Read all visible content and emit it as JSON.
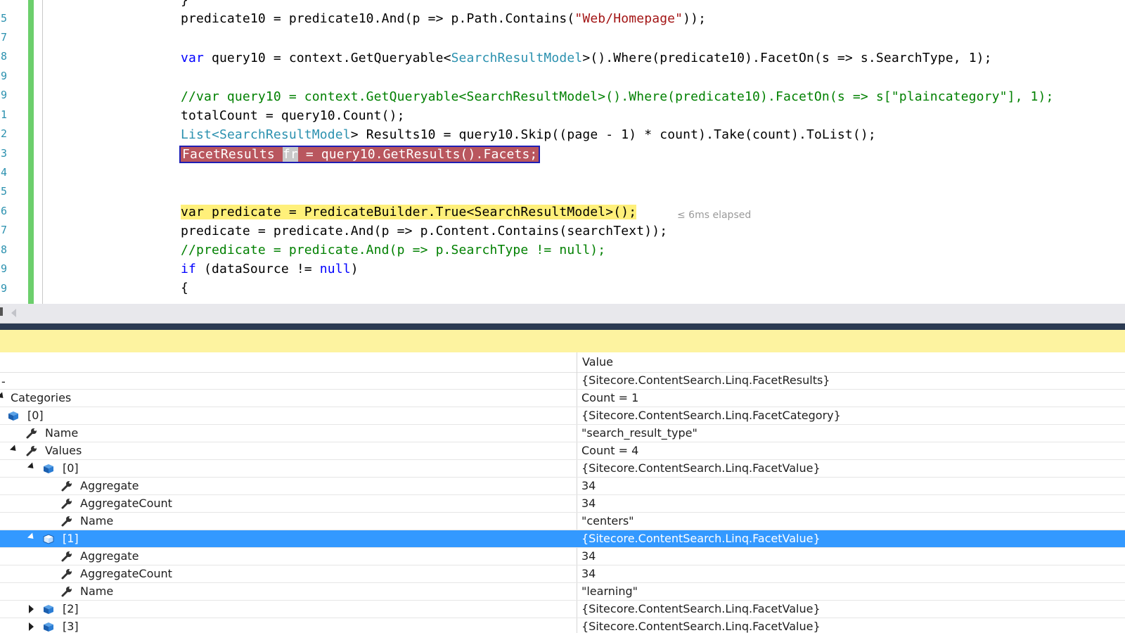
{
  "line_numbers": [
    "5",
    "7",
    "8",
    "9",
    "9",
    "1",
    "2",
    "3",
    "4",
    "5",
    "6",
    "7",
    "8",
    "9",
    "9"
  ],
  "code": {
    "l0": "}",
    "l1_a": "predicate10 = predicate10.And(p => p.Path.Contains(",
    "l1_str": "\"Web/Homepage\"",
    "l1_b": "));",
    "l2_kw": "var",
    "l2_a": " query10 = context.GetQueryable<",
    "l2_type": "SearchResultModel",
    "l2_b": ">().Where(predicate10).FacetOn(s => s.SearchType, 1);",
    "l3_comment": "//var query10 = context.GetQueryable<SearchResultModel>().Where(predicate10).FacetOn(s => s[\"plaincategory\"], 1);",
    "l4": "totalCount = query10.Count();",
    "l5_type1": "List",
    "l5_lt": "<",
    "l5_type2": "SearchResultModel",
    "l5_b": "> Results10 = query10.Skip((page - 1) * count).Take(count).ToList();",
    "l6_a": "FacetResults ",
    "l6_var": "fr",
    "l6_b": " = query10.GetResults().Facets;",
    "l7": "var predicate = PredicateBuilder.True<SearchResultModel>();",
    "l7_elapsed": "≤ 6ms elapsed",
    "l8": "predicate = predicate.And(p => p.Content.Contains(searchText));",
    "l9_comment": "//predicate = predicate.And(p => p.SearchType != null);",
    "l10_kw": "if",
    "l10_a": " (dataSource != ",
    "l10_null": "null",
    "l10_b": ")",
    "l11": "{"
  },
  "watch": {
    "value_header": "Value",
    "rows": [
      {
        "name": "",
        "value": "{Sitecore.ContentSearch.Linq.FacetResults}"
      },
      {
        "name": "Categories",
        "value": "Count = 1"
      },
      {
        "name": "[0]",
        "value": "{Sitecore.ContentSearch.Linq.FacetCategory}"
      },
      {
        "name": "Name",
        "value": "\"search_result_type\""
      },
      {
        "name": "Values",
        "value": "Count = 4"
      },
      {
        "name": "[0]",
        "value": "{Sitecore.ContentSearch.Linq.FacetValue}"
      },
      {
        "name": "Aggregate",
        "value": "34"
      },
      {
        "name": "AggregateCount",
        "value": "34"
      },
      {
        "name": "Name",
        "value": "\"centers\""
      },
      {
        "name": "[1]",
        "value": "{Sitecore.ContentSearch.Linq.FacetValue}"
      },
      {
        "name": "Aggregate",
        "value": "34"
      },
      {
        "name": "AggregateCount",
        "value": "34"
      },
      {
        "name": "Name",
        "value": "\"learning\""
      },
      {
        "name": "[2]",
        "value": "{Sitecore.ContentSearch.Linq.FacetValue}"
      },
      {
        "name": "[3]",
        "value": "{Sitecore.ContentSearch.Linq.FacetValue}"
      }
    ]
  },
  "colors": {
    "keyword": "#0000ff",
    "type": "#2b91af",
    "string": "#a31515",
    "comment": "#008000",
    "active_statement": "#b9565e",
    "current_statement": "#fff07a",
    "selection": "#3399ff",
    "change_bar": "#6ccf6c"
  },
  "icons": {
    "object": "object-cube-icon",
    "property": "wrench-property-icon"
  }
}
